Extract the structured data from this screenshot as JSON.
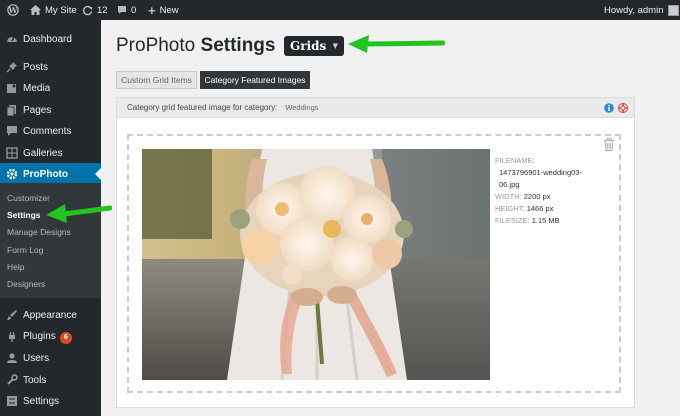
{
  "admin_bar": {
    "site_name": "My Site",
    "updates_count": "12",
    "comments_count": "0",
    "new_label": "New",
    "greeting": "Howdy, admin"
  },
  "sidebar": {
    "items": [
      {
        "label": "Dashboard",
        "icon": "dashboard-icon"
      },
      {
        "label": "Posts",
        "icon": "pin-icon"
      },
      {
        "label": "Media",
        "icon": "media-icon"
      },
      {
        "label": "Pages",
        "icon": "pages-icon"
      },
      {
        "label": "Comments",
        "icon": "comment-icon"
      },
      {
        "label": "Galleries",
        "icon": "gallery-icon"
      },
      {
        "label": "ProPhoto",
        "icon": "gear-icon"
      }
    ],
    "submenu": [
      "Customizer",
      "Settings",
      "Manage Designs",
      "Form Log",
      "Help",
      "Designers"
    ],
    "bottom_items": [
      {
        "label": "Appearance",
        "icon": "brush-icon"
      },
      {
        "label": "Plugins",
        "icon": "plug-icon",
        "badge": "6"
      },
      {
        "label": "Users",
        "icon": "user-icon"
      },
      {
        "label": "Tools",
        "icon": "wrench-icon"
      },
      {
        "label": "Settings",
        "icon": "settings-icon"
      }
    ]
  },
  "main": {
    "title_regular": "ProPhoto",
    "title_bold": "Settings",
    "section_select": "Grids",
    "tabs": [
      "Custom Grid Items",
      "Category Featured Images"
    ],
    "panel": {
      "header_label": "Category grid featured image for category:",
      "category": "Weddings",
      "file": {
        "filename_label": "FILENAME:",
        "filename_line1": "1473796901-wedding03-",
        "filename_line2": "06.jpg",
        "width_label": "WIDTH:",
        "width_value": "2200 px",
        "height_label": "HEIGHT:",
        "height_value": "1466 px",
        "filesize_label": "FILESIZE:",
        "filesize_value": "1.15 MB"
      }
    }
  },
  "colors": {
    "admin_dark": "#23282d",
    "submenu_bg": "#32373c",
    "accent_blue": "#0073aa",
    "arrow_green": "#22c41f",
    "badge_orange": "#d54e21"
  }
}
